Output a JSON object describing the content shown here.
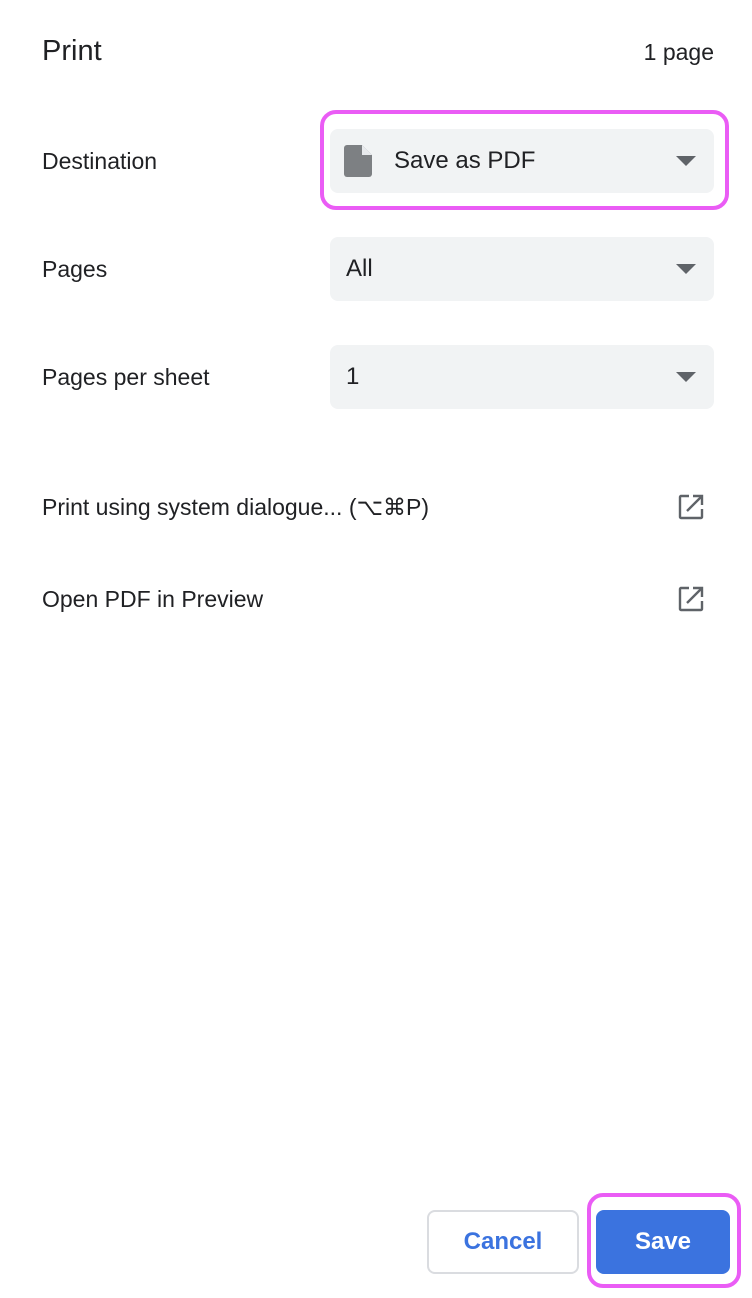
{
  "header": {
    "title": "Print",
    "page_count": "1 page"
  },
  "settings": [
    {
      "label": "Destination",
      "value": "Save as PDF",
      "icon": "document-icon",
      "highlighted": true
    },
    {
      "label": "Pages",
      "value": "All"
    },
    {
      "label": "Pages per sheet",
      "value": "1"
    }
  ],
  "links": [
    {
      "label": "Print using system dialogue... (⌥⌘P)",
      "icon": "open-in-new-icon"
    },
    {
      "label": "Open PDF in Preview",
      "icon": "open-in-new-icon"
    }
  ],
  "footer": {
    "cancel_label": "Cancel",
    "save_label": "Save"
  },
  "colors": {
    "accent": "#3b73df",
    "highlight": "#ea5cf5",
    "select_bg": "#f1f3f4",
    "icon_gray": "#5f6368"
  }
}
